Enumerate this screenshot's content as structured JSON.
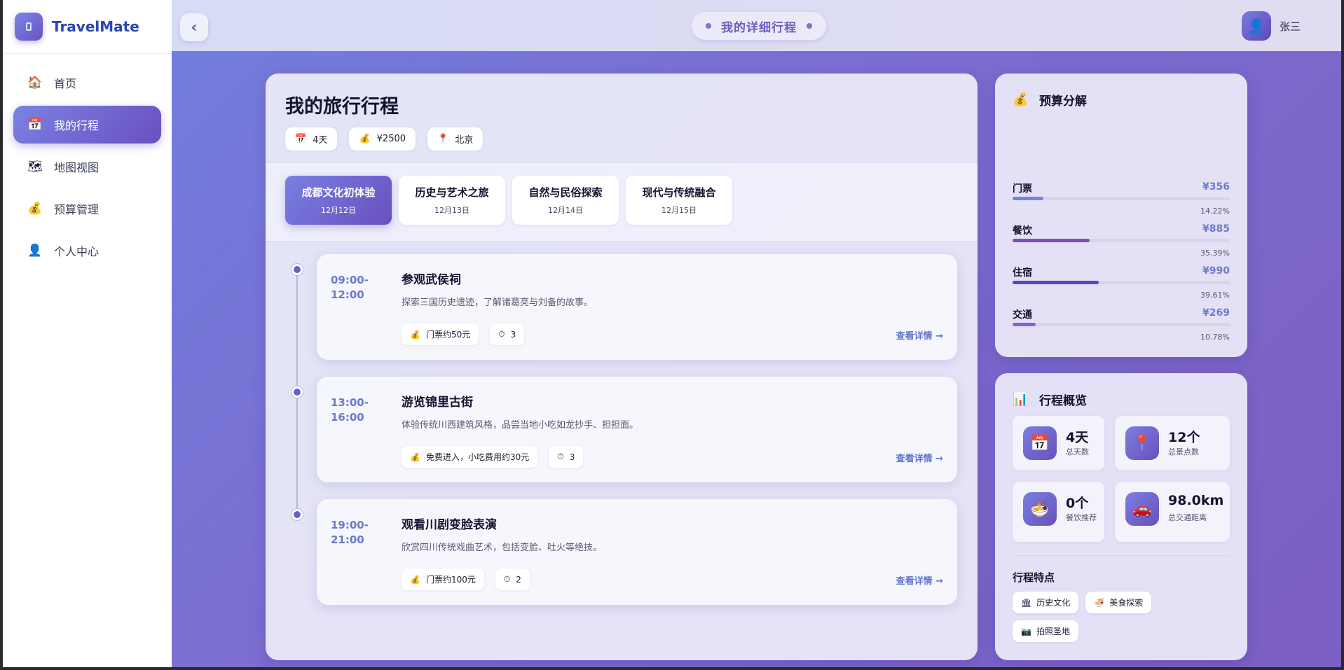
{
  "app": {
    "name": "TravelMate"
  },
  "sidebar": {
    "items": [
      {
        "icon": "house-icon",
        "glyph": "🏠",
        "label": "首页",
        "active": false
      },
      {
        "icon": "calendar-icon",
        "glyph": "📅",
        "label": "我的行程",
        "active": true
      },
      {
        "icon": "map-icon",
        "glyph": "🗺",
        "label": "地图视图",
        "active": false
      },
      {
        "icon": "money-bag-icon",
        "glyph": "💰",
        "label": "预算管理",
        "active": false
      },
      {
        "icon": "person-icon",
        "glyph": "👤",
        "label": "个人中心",
        "active": false
      }
    ]
  },
  "topbar": {
    "back_glyph": "‹",
    "title": "我的详细行程",
    "user_name": "张三",
    "avatar_glyph": "👤"
  },
  "trip": {
    "title": "我的旅行行程",
    "chips": [
      {
        "icon": "calendar-icon",
        "glyph": "📅",
        "text": "4天"
      },
      {
        "icon": "money-bag-icon",
        "glyph": "💰",
        "text": "¥2500"
      },
      {
        "icon": "pin-icon",
        "glyph": "📍",
        "text": "北京"
      }
    ],
    "tabs": [
      {
        "name": "成都文化初体验",
        "date": "12月12日",
        "active": true
      },
      {
        "name": "历史与艺术之旅",
        "date": "12月13日",
        "active": false
      },
      {
        "name": "自然与民俗探索",
        "date": "12月14日",
        "active": false
      },
      {
        "name": "现代与传统融合",
        "date": "12月15日",
        "active": false
      }
    ],
    "activities": [
      {
        "time_start": "09:00-",
        "time_end": "12:00",
        "name": "参观武侯祠",
        "desc": "探索三国历史遗迹，了解诸葛亮与刘备的故事。",
        "cost": "门票约50元",
        "duration": "3",
        "more": "查看详情 →"
      },
      {
        "time_start": "13:00-",
        "time_end": "16:00",
        "name": "游览锦里古街",
        "desc": "体验传统川西建筑风格，品尝当地小吃如龙抄手、担担面。",
        "cost": "免费进入，小吃费用约30元",
        "duration": "3",
        "more": "查看详情 →"
      },
      {
        "time_start": "19:00-",
        "time_end": "21:00",
        "name": "观看川剧变脸表演",
        "desc": "欣赏四川传统戏曲艺术，包括变脸、吐火等绝技。",
        "cost": "门票约100元",
        "duration": "2",
        "more": "查看详情 →"
      }
    ],
    "cost_glyph": "💰",
    "duration_glyph": "⏱"
  },
  "budget": {
    "title": "预算分解",
    "glyph": "💰",
    "rows": [
      {
        "label": "门票",
        "value": "¥356",
        "percent_text": "14.22%",
        "fraction": 0.1422,
        "color": "#6f86dd"
      },
      {
        "label": "餐饮",
        "value": "¥885",
        "percent_text": "35.39%",
        "fraction": 0.3539,
        "color": "#7a4fb8"
      },
      {
        "label": "住宿",
        "value": "¥990",
        "percent_text": "39.61%",
        "fraction": 0.3961,
        "color": "#5b45c8"
      },
      {
        "label": "交通",
        "value": "¥269",
        "percent_text": "10.78%",
        "fraction": 0.1078,
        "color": "#8a5fd6"
      }
    ]
  },
  "overview": {
    "title": "行程概览",
    "glyph": "📊",
    "stats": [
      {
        "icon": "calendar-icon",
        "glyph": "📅",
        "value": "4天",
        "label": "总天数"
      },
      {
        "icon": "pin-icon",
        "glyph": "📍",
        "value": "12个",
        "label": "总景点数"
      },
      {
        "icon": "food-icon",
        "glyph": "🍜",
        "value": "0个",
        "label": "餐饮推荐"
      },
      {
        "icon": "car-icon",
        "glyph": "🚗",
        "value": "98.0km",
        "label": "总交通距离"
      }
    ],
    "features_title": "行程特点",
    "features": [
      {
        "icon": "museum-icon",
        "glyph": "🏛",
        "text": "历史文化"
      },
      {
        "icon": "food-icon",
        "glyph": "🍜",
        "text": "美食探索"
      },
      {
        "icon": "camera-icon",
        "glyph": "📷",
        "text": "拍照圣地"
      }
    ]
  },
  "colors": {
    "accent": "#6a4fbf",
    "accent_light": "#7b82e4",
    "brand": "#2746b8",
    "link": "#6276c9"
  }
}
